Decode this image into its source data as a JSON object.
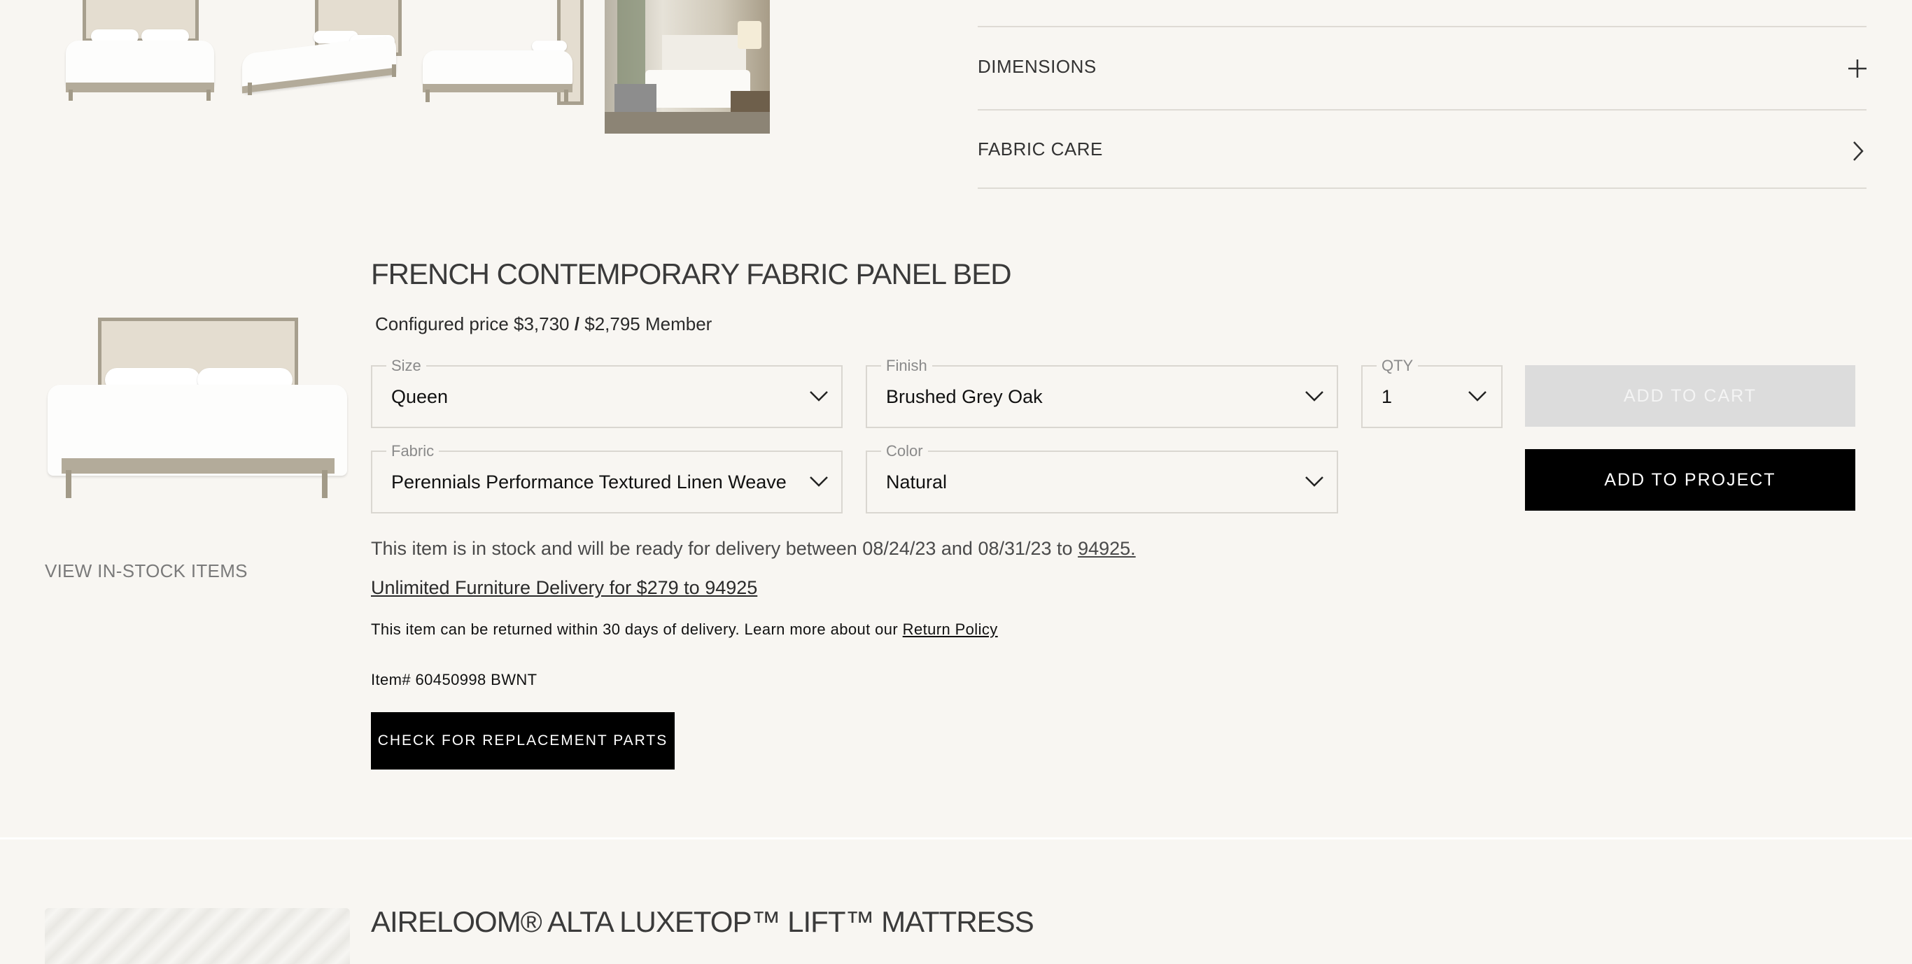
{
  "accordion": [
    {
      "label": "DIMENSIONS",
      "icon": "plus-icon"
    },
    {
      "label": "FABRIC CARE",
      "icon": "chevron-right-icon"
    }
  ],
  "product": {
    "title": "FRENCH CONTEMPORARY FABRIC PANEL BED",
    "price_text": "Configured price $3,730",
    "price_sep": "/",
    "member_text": "$2,795 Member",
    "view_in_stock": "VIEW IN-STOCK ITEMS",
    "size": {
      "label": "Size",
      "value": "Queen"
    },
    "finish": {
      "label": "Finish",
      "value": "Brushed Grey Oak"
    },
    "qty": {
      "label": "QTY",
      "value": "1"
    },
    "fabric": {
      "label": "Fabric",
      "value": "Perennials Performance Textured Linen Weave"
    },
    "color": {
      "label": "Color",
      "value": "Natural"
    },
    "add_to_cart": "ADD TO CART",
    "add_to_project": "ADD TO PROJECT",
    "delivery_text": "This item is in stock and will be ready for delivery between 08/24/23 and 08/31/23 to",
    "delivery_zip": "94925.",
    "unlimited_delivery": "Unlimited Furniture Delivery for $279 to 94925",
    "return_text": "This item can be returned within 30 days of delivery. Learn more about our",
    "return_link": "Return Policy",
    "item_number": "Item# 60450998 BWNT",
    "replacement_parts": "CHECK FOR REPLACEMENT PARTS"
  },
  "next_product": {
    "title": "AIRELOOM® ALTA LUXETOP™ LIFT™ MATTRESS"
  },
  "colors": {
    "background": "#f8f6f2",
    "button_black": "#000000",
    "button_disabled": "#dcdcdc"
  }
}
